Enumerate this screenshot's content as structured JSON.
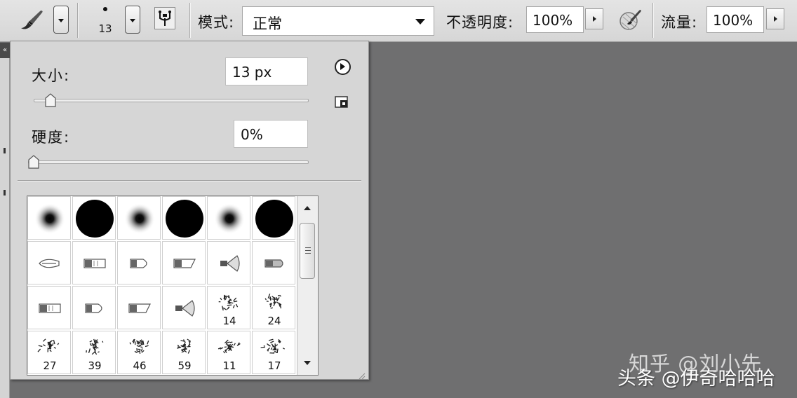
{
  "options_bar": {
    "tool_icon": "brush-icon",
    "brush_size": "13",
    "airbrush_icon": "airbrush-icon",
    "mode_label": "模式:",
    "mode_value": "正常",
    "opacity_label": "不透明度:",
    "opacity_value": "100%",
    "tablet_icon": "tablet-pressure-icon",
    "flow_label": "流量:",
    "flow_value": "100%"
  },
  "brush_popup": {
    "size_label": "大小:",
    "size_value": "13 px",
    "size_slider": 0.1,
    "hardness_label": "硬度:",
    "hardness_value": "0%",
    "hardness_slider": 0.0,
    "menu_icon": "flyout-menu-icon",
    "reset_icon": "new-preset-icon",
    "presets": [
      {
        "shape": "soft-round",
        "label": ""
      },
      {
        "shape": "hard-round",
        "label": ""
      },
      {
        "shape": "soft-round",
        "label": ""
      },
      {
        "shape": "hard-round",
        "label": ""
      },
      {
        "shape": "soft-round",
        "label": ""
      },
      {
        "shape": "hard-round",
        "label": ""
      },
      {
        "shape": "brush-pointed",
        "label": ""
      },
      {
        "shape": "brush-flat",
        "label": ""
      },
      {
        "shape": "brush-round-tip",
        "label": ""
      },
      {
        "shape": "brush-angle",
        "label": ""
      },
      {
        "shape": "brush-fan",
        "label": ""
      },
      {
        "shape": "brush-blunt",
        "label": ""
      },
      {
        "shape": "brush-flat",
        "label": ""
      },
      {
        "shape": "brush-round-tip",
        "label": ""
      },
      {
        "shape": "brush-angle",
        "label": ""
      },
      {
        "shape": "brush-fan",
        "label": ""
      },
      {
        "shape": "spatter",
        "label": "14"
      },
      {
        "shape": "spatter",
        "label": "24"
      },
      {
        "shape": "spatter",
        "label": "27"
      },
      {
        "shape": "spatter",
        "label": "39"
      },
      {
        "shape": "spatter",
        "label": "46"
      },
      {
        "shape": "spatter",
        "label": "59"
      },
      {
        "shape": "spatter",
        "label": "11"
      },
      {
        "shape": "spatter",
        "label": "17"
      }
    ]
  },
  "watermarks": {
    "zhihu": "知乎 @刘小先",
    "toutiao": "头条 @伊奇哈哈哈"
  }
}
